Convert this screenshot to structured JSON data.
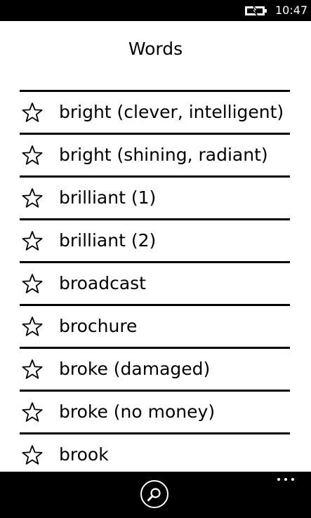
{
  "status_bar": {
    "time": "10:47",
    "icons": [
      "battery-charging-icon"
    ]
  },
  "header": {
    "title": "Words"
  },
  "word_list": {
    "items": [
      {
        "label": "bright (clever, intelligent)",
        "icon": "star-outline-icon"
      },
      {
        "label": "bright (shining, radiant)",
        "icon": "star-outline-icon"
      },
      {
        "label": "brilliant (1)",
        "icon": "star-outline-icon"
      },
      {
        "label": "brilliant (2)",
        "icon": "star-outline-icon"
      },
      {
        "label": "broadcast",
        "icon": "star-outline-icon"
      },
      {
        "label": "brochure",
        "icon": "star-outline-icon"
      },
      {
        "label": "broke (damaged)",
        "icon": "star-outline-icon"
      },
      {
        "label": "broke (no money)",
        "icon": "star-outline-icon"
      },
      {
        "label": "brook",
        "icon": "star-outline-icon"
      }
    ]
  },
  "app_bar": {
    "buttons": [
      "search-icon",
      "more-icon"
    ]
  },
  "colors": {
    "background": "#ffffff",
    "text": "#000000",
    "bars": "#000000"
  }
}
